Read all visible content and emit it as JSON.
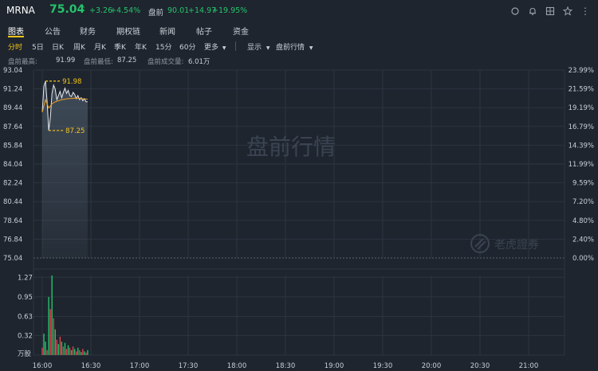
{
  "header": {
    "ticker": "MRNA",
    "price": "75.04",
    "arrow": "↑",
    "change": "+3.26",
    "change_pct": "+4.54%",
    "premarket_label": "盘前",
    "premarket_price": "90.01",
    "premarket_change": "+14.97",
    "premarket_change_pct": "+19.95%",
    "colors": {
      "up": "#26c26b",
      "accent": "#f5c518",
      "bg": "#1e252e"
    }
  },
  "icons": [
    "refresh-icon",
    "bell-icon",
    "grid-icon",
    "star-icon"
  ],
  "nav": {
    "tabs": [
      "图表",
      "公告",
      "财务",
      "期权链",
      "新闻",
      "帖子",
      "资金"
    ],
    "active": 0
  },
  "toolbar": {
    "periods": [
      "分时",
      "5日",
      "日K",
      "周K",
      "月K",
      "季K",
      "年K",
      "15分",
      "60分",
      "更多"
    ],
    "active": 0,
    "display_label": "显示",
    "premarket_quote_label": "盘前行情"
  },
  "stats": {
    "high_label": "盘前最高:",
    "high_value": "91.99",
    "low_label": "盘前最低:",
    "low_value": "87.25",
    "volume_label": "盘前成交量:",
    "volume_value": "6.01万"
  },
  "chart_data": {
    "type": "line",
    "title": "",
    "watermark": "盘前行情",
    "logo_text": "老虎證券",
    "y_ticks_left": [
      "93.04",
      "91.24",
      "89.44",
      "87.64",
      "85.84",
      "84.04",
      "82.24",
      "80.44",
      "78.64",
      "76.84",
      "75.04"
    ],
    "y_ticks_right": [
      "23.99%",
      "21.59%",
      "19.19%",
      "16.79%",
      "14.39%",
      "11.99%",
      "9.59%",
      "7.20%",
      "4.80%",
      "2.40%",
      "0.00%"
    ],
    "ylim": [
      75.04,
      93.04
    ],
    "baseline": 75.04,
    "high_marker": "91.98",
    "low_marker": "87.25",
    "x_ticks": [
      "16:00",
      "16:30",
      "17:00",
      "17:30",
      "18:00",
      "18:30",
      "19:00",
      "19:30",
      "20:00",
      "20:30",
      "21:00"
    ],
    "price_series": {
      "minutes_from_1600": [
        0,
        1,
        2,
        3,
        4,
        5,
        6,
        7,
        8,
        9,
        10,
        11,
        12,
        13,
        14,
        15,
        16,
        17,
        18,
        19,
        20,
        21,
        22,
        23,
        24,
        25,
        26,
        27,
        28
      ],
      "values": [
        89.0,
        91.5,
        91.98,
        90.0,
        87.25,
        88.5,
        90.8,
        91.6,
        91.2,
        90.2,
        90.6,
        91.0,
        90.4,
        90.9,
        91.3,
        90.8,
        91.1,
        90.6,
        90.5,
        90.9,
        90.7,
        90.3,
        90.6,
        90.2,
        90.4,
        90.1,
        90.3,
        90.0,
        90.01
      ]
    },
    "avg_series": {
      "minutes_from_1600": [
        0,
        2,
        4,
        6,
        8,
        10,
        12,
        14,
        16,
        18,
        20,
        22,
        24,
        26,
        28
      ],
      "values": [
        89.0,
        90.2,
        89.4,
        89.8,
        90.0,
        90.1,
        90.2,
        90.25,
        90.3,
        90.32,
        90.35,
        90.33,
        90.3,
        90.28,
        90.25
      ]
    },
    "volume": {
      "y_ticks": [
        "1.27",
        "0.95",
        "0.63",
        "0.32",
        "万股"
      ],
      "ylim": [
        0,
        1.3
      ],
      "values": [
        0.12,
        0.35,
        0.22,
        0.08,
        0.95,
        0.75,
        1.3,
        0.6,
        0.42,
        0.25,
        0.18,
        0.3,
        0.22,
        0.14,
        0.2,
        0.1,
        0.16,
        0.12,
        0.08,
        0.14,
        0.1,
        0.06,
        0.12,
        0.08,
        0.05,
        0.1,
        0.06,
        0.04,
        0.08
      ],
      "up": [
        false,
        true,
        true,
        false,
        true,
        false,
        true,
        false,
        true,
        false,
        true,
        false,
        true,
        false,
        true,
        false,
        true,
        false,
        true,
        false,
        true,
        false,
        true,
        false,
        true,
        false,
        true,
        false,
        true
      ]
    }
  }
}
